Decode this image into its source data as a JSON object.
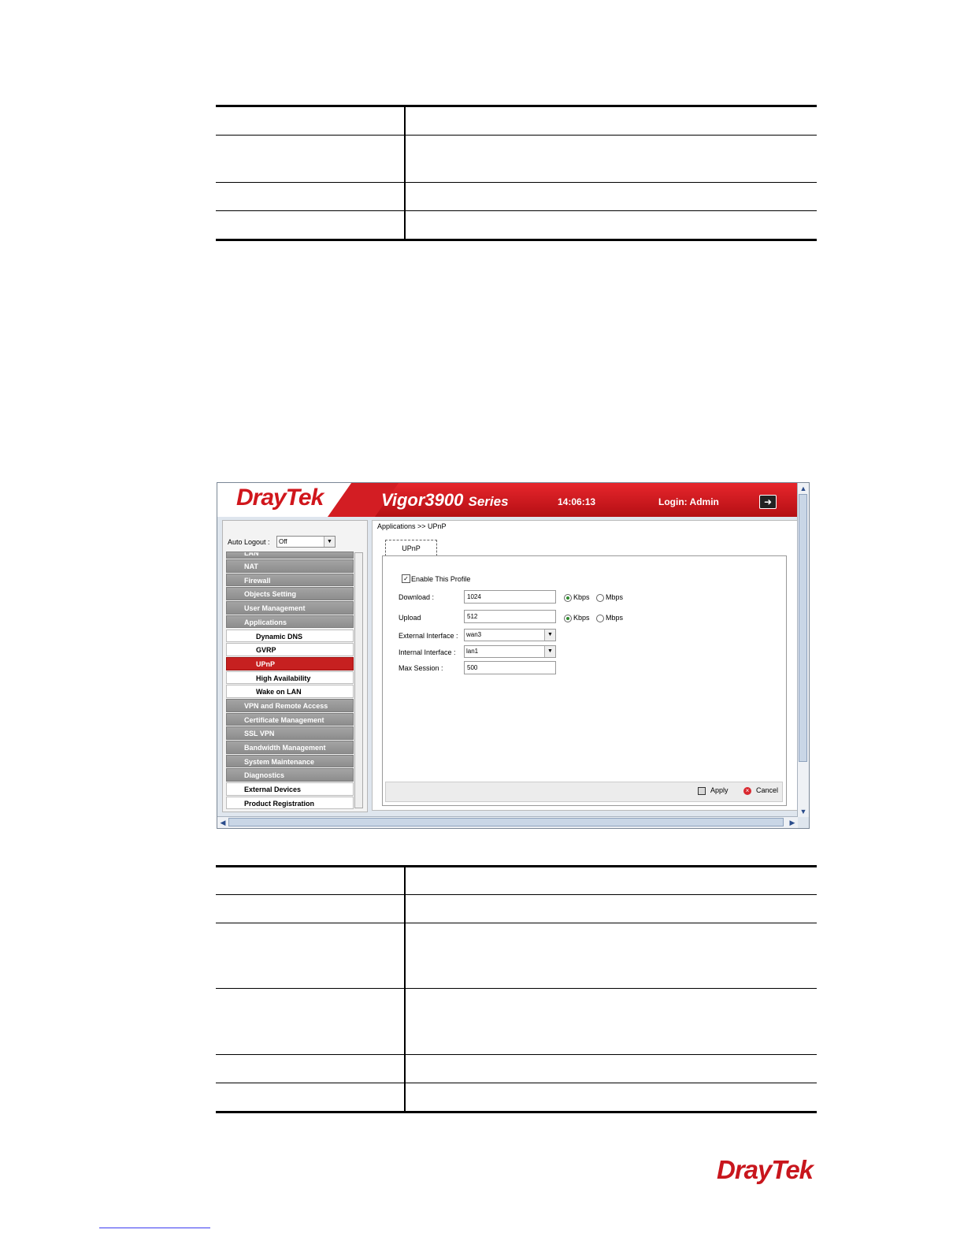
{
  "screenshot": {
    "logo": "DrayTek",
    "model": "Vigor3900",
    "series": "Series",
    "time": "14:06:13",
    "login": "Login: Admin",
    "auto_logout_label": "Auto Logout :",
    "auto_logout_value": "Off",
    "menu": [
      {
        "label": "LAN",
        "kind": "cat"
      },
      {
        "label": "NAT",
        "kind": "cat"
      },
      {
        "label": "Firewall",
        "kind": "cat"
      },
      {
        "label": "Objects Setting",
        "kind": "cat"
      },
      {
        "label": "User Management",
        "kind": "cat"
      },
      {
        "label": "Applications",
        "kind": "cat"
      },
      {
        "label": "Dynamic DNS",
        "kind": "sub"
      },
      {
        "label": "GVRP",
        "kind": "sub"
      },
      {
        "label": "UPnP",
        "kind": "sub-active"
      },
      {
        "label": "High Availability",
        "kind": "sub"
      },
      {
        "label": "Wake on LAN",
        "kind": "sub"
      },
      {
        "label": "VPN and Remote Access",
        "kind": "cat"
      },
      {
        "label": "Certificate Management",
        "kind": "cat"
      },
      {
        "label": "SSL VPN",
        "kind": "cat"
      },
      {
        "label": "Bandwidth Management",
        "kind": "cat"
      },
      {
        "label": "System Maintenance",
        "kind": "cat"
      },
      {
        "label": "Diagnostics",
        "kind": "cat"
      },
      {
        "label": "External Devices",
        "kind": "plain"
      },
      {
        "label": "Product Registration",
        "kind": "plain"
      }
    ],
    "breadcrumb": "Applications >> UPnP",
    "tab": "UPnP",
    "form": {
      "enable_label": "Enable This Profile",
      "download_label": "Download :",
      "download_value": "1024",
      "upload_label": "Upload",
      "upload_value": "512",
      "kbps": "Kbps",
      "mbps": "Mbps",
      "external_label": "External Interface :",
      "external_value": "wan3",
      "internal_label": "Internal Interface :",
      "internal_value": "lan1",
      "max_session_label": "Max Session :",
      "max_session_value": "500"
    },
    "apply": "Apply",
    "cancel": "Cancel"
  },
  "footer_logo": "DrayTek"
}
